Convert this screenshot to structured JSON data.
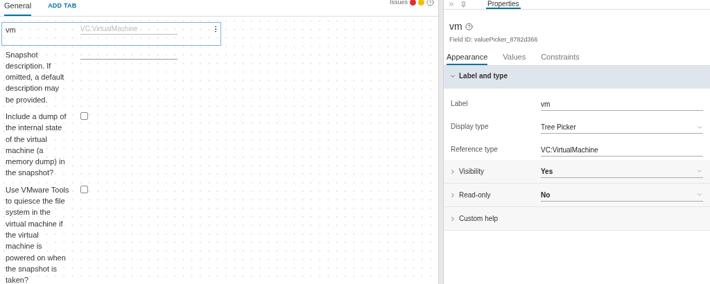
{
  "designer": {
    "tabs": [
      {
        "label": "General",
        "selected": true
      }
    ],
    "add_tab": "ADD TAB",
    "issues": {
      "label": "Issues",
      "indicators": [
        {
          "color": "#d9342b"
        },
        {
          "color": "#f0c000"
        }
      ]
    },
    "fields": [
      {
        "kind": "picker",
        "label": "vm",
        "placeholder": "VC:VirtualMachine",
        "selected": true
      },
      {
        "kind": "text",
        "label": "Snapshot description. If omitted, a default description may be provided.",
        "selected": false
      },
      {
        "kind": "checkbox",
        "label": "Include a dump of the internal state of the virtual machine (a memory dump) in the snapshot?",
        "checked": false,
        "selected": false
      },
      {
        "kind": "checkbox",
        "label": "Use VMware Tools to quiesce the file system in the virtual machine if the virtual machine is powered on when the snapshot is taken?",
        "checked": false,
        "selected": false
      }
    ]
  },
  "properties": {
    "tabs": [
      {
        "label": "Properties",
        "selected": true
      }
    ],
    "field_name": "vm",
    "field_id": "Field ID: valuePicker_8782d366",
    "sub_tabs": [
      {
        "label": "Appearance",
        "selected": true
      },
      {
        "label": "Values",
        "selected": false
      },
      {
        "label": "Constraints",
        "selected": false
      }
    ],
    "sections": [
      {
        "title": "Label and type",
        "expanded": true,
        "rows": [
          {
            "kind": "text",
            "label": "Label",
            "value": "vm"
          },
          {
            "kind": "select",
            "label": "Display type",
            "value": "Tree Picker"
          },
          {
            "kind": "text",
            "label": "Reference type",
            "value": "VC:VirtualMachine"
          }
        ]
      },
      {
        "title": "Visibility",
        "expanded": false,
        "value": "Yes"
      },
      {
        "title": "Read-only",
        "expanded": false,
        "value": "No"
      },
      {
        "title": "Custom help",
        "expanded": false
      }
    ]
  }
}
